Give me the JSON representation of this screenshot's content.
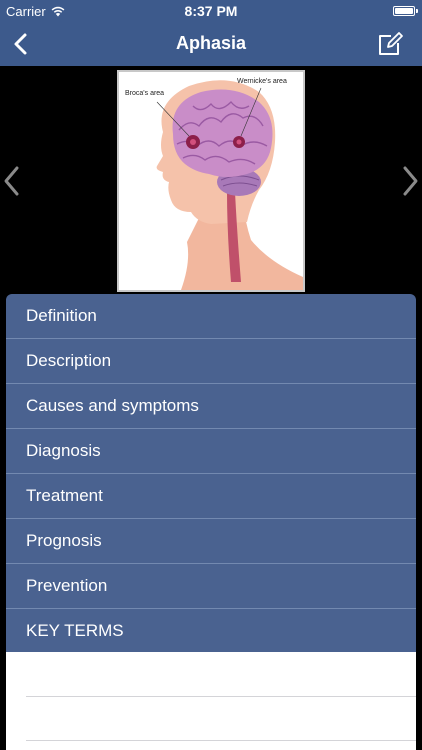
{
  "status_bar": {
    "carrier": "Carrier",
    "time": "8:37 PM",
    "wifi_icon": "wifi-icon",
    "battery_icon": "battery-icon",
    "battery_level": 1.0
  },
  "nav": {
    "title": "Aphasia",
    "back_icon": "chevron-left-icon",
    "compose_icon": "compose-icon"
  },
  "figure": {
    "labels": {
      "broca": "Broca's area",
      "wernicke": "Wernicke's area"
    },
    "prev_icon": "chevron-left-icon",
    "next_icon": "chevron-right-icon"
  },
  "sections": [
    {
      "label": "Definition"
    },
    {
      "label": "Description"
    },
    {
      "label": "Causes and symptoms"
    },
    {
      "label": "Diagnosis"
    },
    {
      "label": "Treatment"
    },
    {
      "label": "Prognosis"
    },
    {
      "label": "Prevention"
    },
    {
      "label": "KEY TERMS"
    }
  ],
  "colors": {
    "nav_background": "#3d5a8c",
    "section_background": "#4a6290",
    "section_divider": "#7389b0",
    "page_background": "#000000"
  }
}
